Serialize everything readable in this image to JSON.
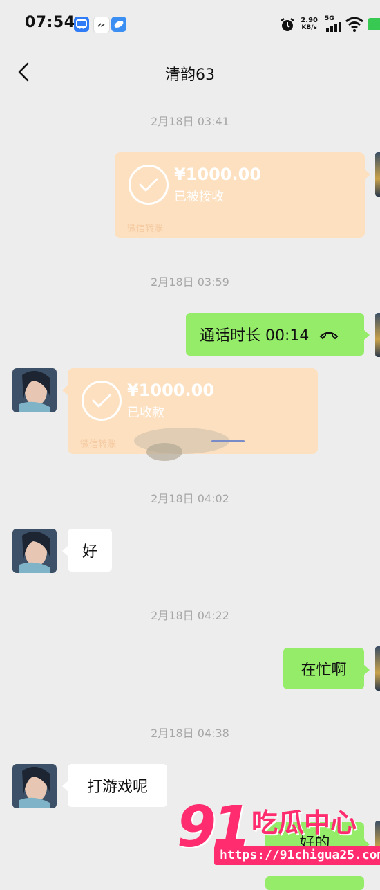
{
  "status_bar": {
    "time": "07:54",
    "net_speed_value": "2.90",
    "net_speed_unit": "KB/s",
    "network_type": "5G",
    "icons": [
      "app-notification-icon",
      "app-notification-icon",
      "app-notification-icon",
      "alarm-icon",
      "signal-icon",
      "wifi-icon",
      "battery-icon"
    ]
  },
  "header": {
    "title": "清韵63",
    "back_icon": "chevron-left-icon"
  },
  "messages": {
    "ts1": "2月18日 03:41",
    "transfer1": {
      "amount": "¥1000.00",
      "status": "已被接收",
      "footer": "微信转账"
    },
    "ts2": "2月18日 03:59",
    "call": {
      "text": "通话时长 00:14",
      "icon": "phone-hangup-icon"
    },
    "transfer2": {
      "amount": "¥1000.00",
      "status": "已收款",
      "footer": "微信转账"
    },
    "ts3": "2月18日 04:02",
    "msg_hao": "好",
    "ts4": "2月18日 04:22",
    "msg_busy": "在忙啊",
    "ts5": "2月18日 04:38",
    "msg_game": "打游戏呢",
    "msg_partial": "好的"
  },
  "watermark": {
    "logo": "91",
    "brand": "吃瓜中心",
    "url": "https://91chigua25.com"
  },
  "colors": {
    "sent_bubble": "#95ec69",
    "received_bubble": "#ffffff",
    "transfer_bubble": "#fde0c0",
    "background": "#ededed",
    "watermark": "#ff2d6f"
  }
}
